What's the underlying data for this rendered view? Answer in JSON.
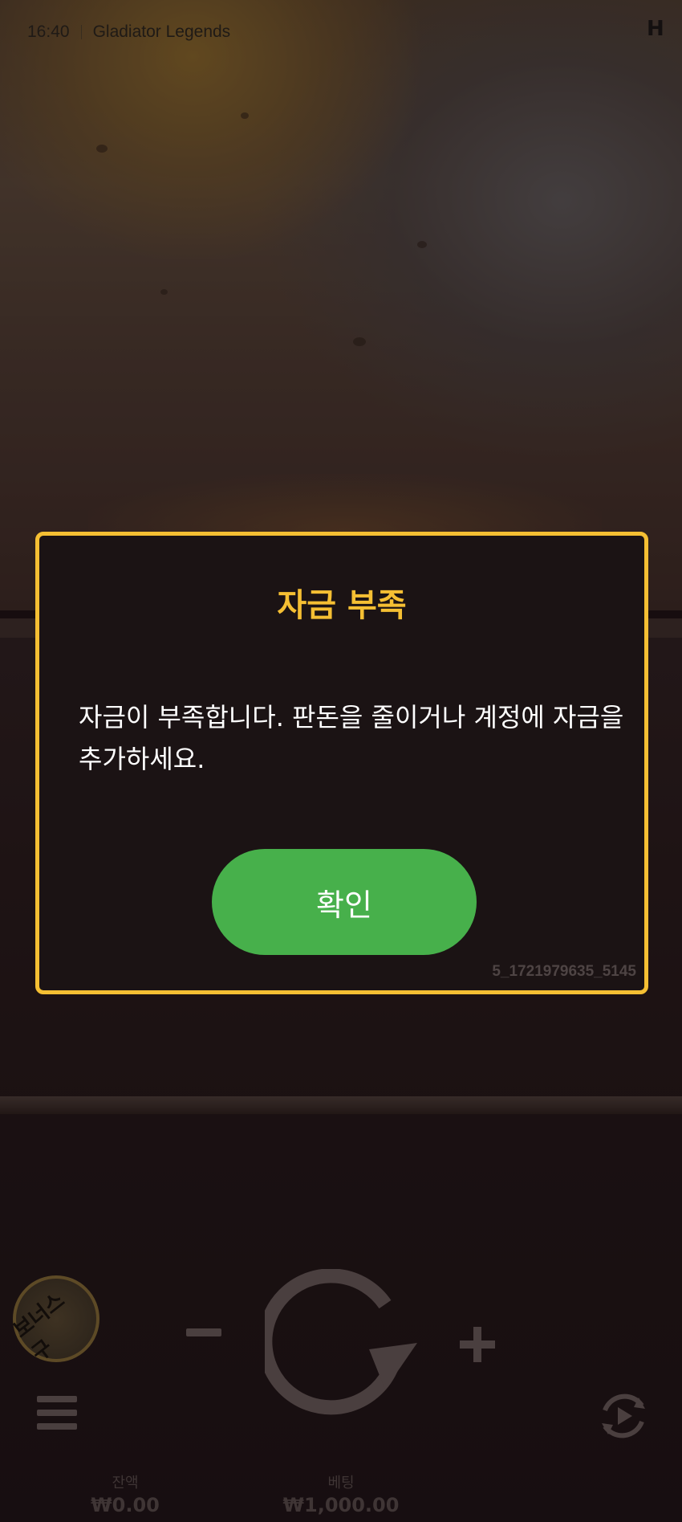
{
  "header": {
    "time": "16:40",
    "game_title": "Gladiator Legends",
    "brand_logo": "H"
  },
  "dialog": {
    "title": "자금 부족",
    "message": "자금이 부족합니다. 판돈을 줄이거나 계정에 자금을 추가하세요.",
    "confirm_label": "확인",
    "session_id": "5_1721979635_5145"
  },
  "controls": {
    "bonus_buy_label": "보너스 구",
    "spin_icon": "spin-icon",
    "menu_icon": "menu-icon",
    "autoplay_icon": "autoplay-icon"
  },
  "stats": {
    "balance_label": "잔액",
    "balance_value": "₩0.00",
    "bet_label": "베팅",
    "bet_value": "₩1,000.00"
  },
  "colors": {
    "accent": "#f5bf33",
    "confirm": "#47b04b",
    "dialog_bg": "#1b1314"
  }
}
